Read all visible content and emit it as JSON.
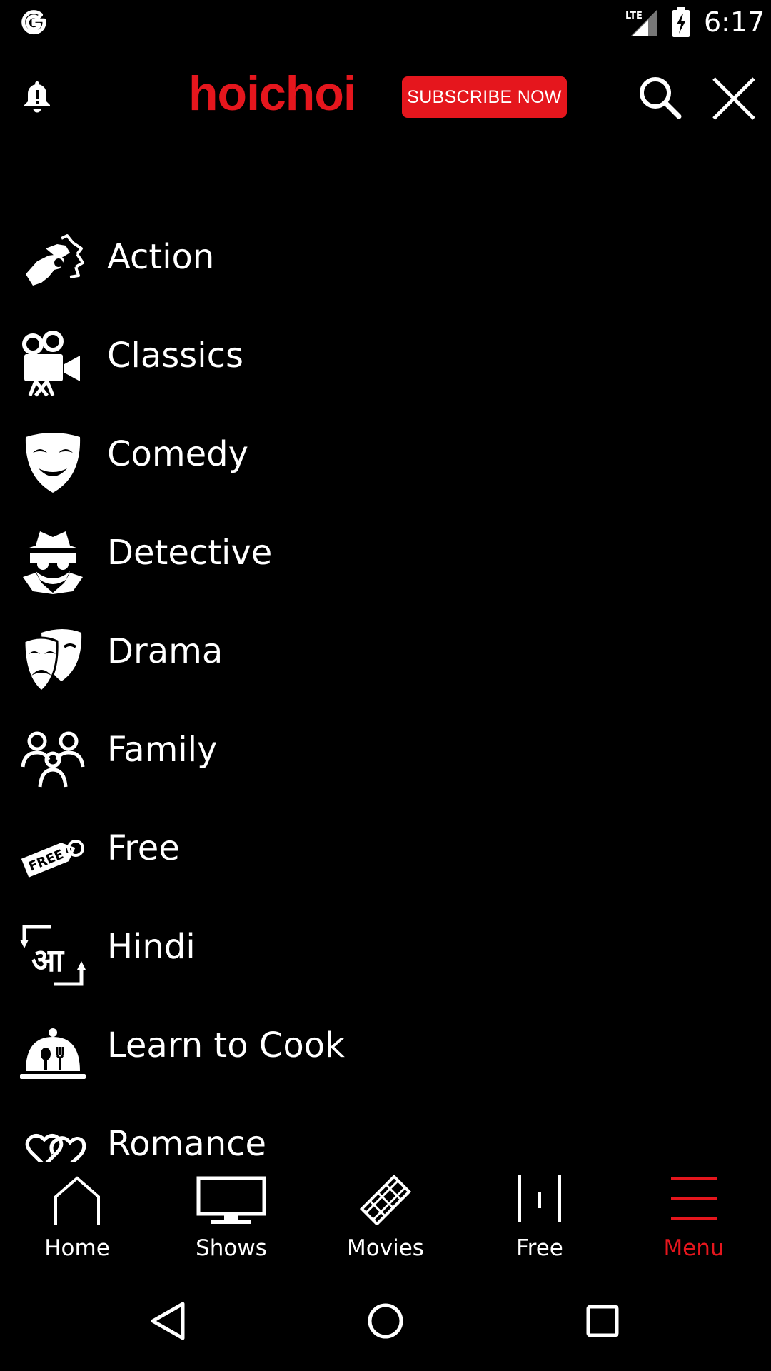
{
  "status_bar": {
    "carrier_icon": "google-g-icon",
    "network": "LTE",
    "time": "6:17"
  },
  "header": {
    "logo_text": "hoichoi",
    "subscribe_label": "SUBSCRIBE NOW",
    "accent_color": "#e5161d"
  },
  "menu": {
    "items": [
      {
        "label": "Action",
        "icon": "fist-icon"
      },
      {
        "label": "Classics",
        "icon": "movie-camera-icon"
      },
      {
        "label": "Comedy",
        "icon": "comedy-mask-icon"
      },
      {
        "label": "Detective",
        "icon": "detective-icon"
      },
      {
        "label": "Drama",
        "icon": "drama-masks-icon"
      },
      {
        "label": "Family",
        "icon": "family-icon"
      },
      {
        "label": "Free",
        "icon": "free-tag-icon",
        "tag_text": "FREE"
      },
      {
        "label": "Hindi",
        "icon": "hindi-language-icon",
        "glyph": "आ"
      },
      {
        "label": "Learn to Cook",
        "icon": "cloche-icon"
      },
      {
        "label": "Romance",
        "icon": "hearts-icon"
      }
    ]
  },
  "bottom_nav": {
    "items": [
      {
        "label": "Home",
        "icon": "home-icon"
      },
      {
        "label": "Shows",
        "icon": "tv-icon"
      },
      {
        "label": "Movies",
        "icon": "film-strip-icon"
      },
      {
        "label": "Free",
        "icon": "free-bars-icon"
      },
      {
        "label": "Menu",
        "icon": "menu-icon",
        "active": true
      }
    ]
  },
  "system_nav": {
    "back": "back-icon",
    "home": "home-circle-icon",
    "recents": "recents-icon"
  }
}
